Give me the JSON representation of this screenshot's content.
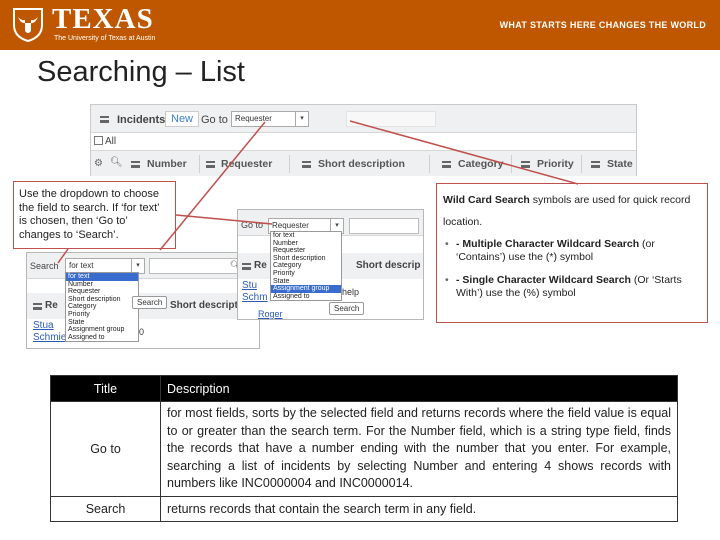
{
  "header": {
    "logo_text": "TEXAS",
    "logo_subtitle": "The University of Texas at Austin",
    "tagline": "WHAT STARTS HERE CHANGES THE WORLD",
    "brand_color": "#bf5700"
  },
  "slide_title": "Searching – List",
  "list_screenshot": {
    "title": "Incidents",
    "new_button": "New",
    "goto_label": "Go to",
    "goto_value": "Requester",
    "filter_all": "All",
    "columns": [
      "Number",
      "Requester",
      "Short description",
      "Category",
      "Priority",
      "State"
    ]
  },
  "callout_left": {
    "text": "Use the dropdown to choose the field to search. If ‘for text’ is chosen, then ‘Go to’ changes to ‘Search’."
  },
  "shot_left": {
    "search_label": "Search",
    "select_value": "for text",
    "options": [
      "for text",
      "Number",
      "Requester",
      "Short description",
      "Category",
      "Priority",
      "State",
      "Assignment group",
      "Assigned to"
    ],
    "search_button": "Search",
    "header_fragment": "Re",
    "header_short": "Short description",
    "row_fragments": [
      "Stua",
      "Schmied"
    ],
    "row_tail": "0"
  },
  "shot_mid": {
    "goto_label": "Go to",
    "select_value": "Requester",
    "options": [
      "for text",
      "Number",
      "Requester",
      "Short description",
      "Category",
      "Priority",
      "State",
      "Assignment group",
      "Assigned to"
    ],
    "search_button": "Search",
    "header_fragment": "Re",
    "header_short": "Short descrip",
    "row_fragments": [
      "Stu",
      "Schm"
    ],
    "row_help": "help",
    "row_last": "Roger"
  },
  "callout_right": {
    "intro_bold": "Wild Card Search",
    "intro_rest": " symbols are used for quick record",
    "location": "location.",
    "bullets": [
      {
        "bold": "- Multiple Character Wildcard Search",
        "rest": " (or ‘Contains’) use the (*) symbol"
      },
      {
        "bold": "- Single Character Wildcard Search",
        "rest": " (Or ‘Starts With’) use the (%) symbol"
      }
    ]
  },
  "desc_table": {
    "headers": [
      "Title",
      "Description"
    ],
    "rows": [
      {
        "title": "Go to",
        "description": "for most fields, sorts by the selected field and returns records where the field value is equal to or greater than the search term. For the Number field, which is a string type field, finds the records that have a number ending with the number that you enter. For example, searching a list of incidents by selecting Number and entering 4 shows records with numbers like INC0000004 and INC0000014."
      },
      {
        "title": "Search",
        "description": "returns records that contain the search term in any field."
      }
    ]
  },
  "colors": {
    "callout_border": "#c0504d",
    "highlight": "#3a6ccf",
    "link_blue": "#3a7ed0"
  }
}
